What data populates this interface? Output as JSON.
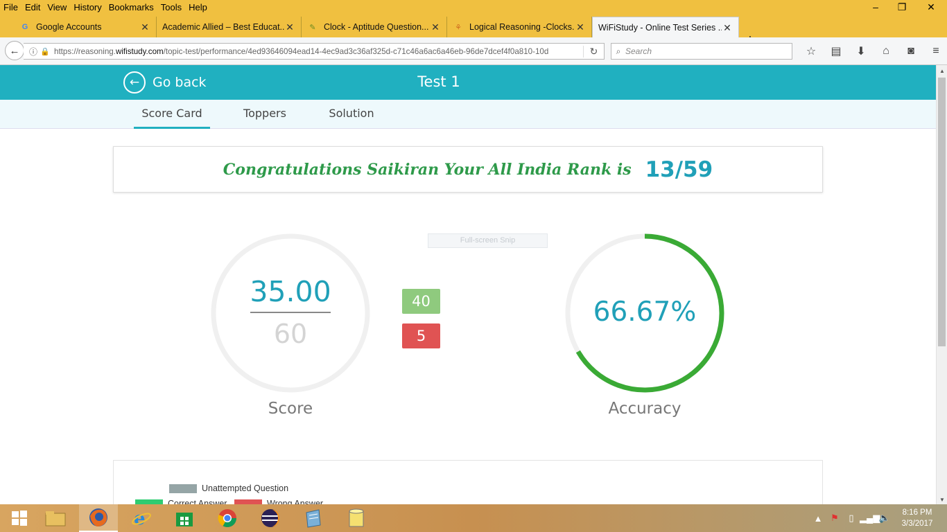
{
  "menu": [
    "File",
    "Edit",
    "View",
    "History",
    "Bookmarks",
    "Tools",
    "Help"
  ],
  "window_controls": {
    "minimize": "–",
    "restore": "❐",
    "close": "✕"
  },
  "tabs": [
    {
      "title": "Google Accounts",
      "favicon": "G",
      "icon": "google-icon"
    },
    {
      "title": "Academic Allied – Best Educat...",
      "favicon": "",
      "icon": "blank-icon"
    },
    {
      "title": "Clock - Aptitude Question...",
      "favicon": "✎",
      "icon": "pencil-icon"
    },
    {
      "title": "Logical Reasoning -Clocks...",
      "favicon": "⚘",
      "icon": "figure-icon"
    },
    {
      "title": "WiFiStudy - Online Test Series ...",
      "favicon": "",
      "icon": "blank-icon"
    }
  ],
  "newtab_symbol": "+",
  "url": {
    "prefix": "https://reasoning.",
    "domain": "wifistudy.com",
    "path": "/topic-test/performance/4ed93646094ead14-4ec9ad3c36af325d-c71c46a6ac6a46eb-96de7dcef4f0a810-10d"
  },
  "search_placeholder": "Search",
  "page": {
    "go_back": "Go back",
    "title": "Test 1",
    "subtabs": [
      "Score Card",
      "Toppers",
      "Solution"
    ],
    "congrats": "Congratulations Saikiran Your All India Rank is",
    "rank": "13/59",
    "snip_label": "Full-screen Snip",
    "score": "35.00",
    "score_total": "60",
    "score_fraction": 0.5833,
    "score_label": "Score",
    "correct_count": "40",
    "wrong_count": "5",
    "accuracy": "66.67%",
    "accuracy_fraction": 0.6667,
    "accuracy_label": "Accuracy",
    "legend": {
      "unattempted": "Unattempted Question",
      "correct": "Correct Answer",
      "wrong": "Wrong Answer"
    }
  },
  "colors": {
    "brand": "#20b0c0",
    "correct": "#2ecc71",
    "correct_badge": "#8fca7e",
    "wrong": "#e05353",
    "unattempted": "#95a5a6",
    "accuracy_arc": "#3aaa35"
  },
  "taskbar": {
    "apps": [
      "windows-start",
      "file-explorer",
      "firefox",
      "internet-explorer",
      "windows-store",
      "chrome",
      "eclipse",
      "notepad",
      "database"
    ],
    "time": "8:16 PM",
    "date": "3/3/2017"
  }
}
